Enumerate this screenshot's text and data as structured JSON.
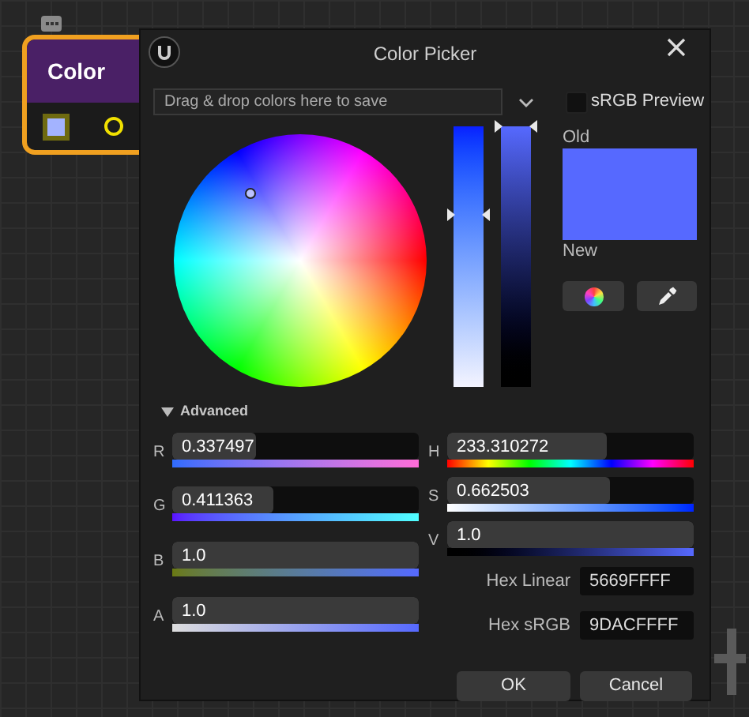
{
  "node": {
    "title": "Color"
  },
  "dialog": {
    "title": "Color Picker"
  },
  "swatch_bar": {
    "placeholder": "Drag & drop colors here to save"
  },
  "srgb_preview": {
    "label": "sRGB Preview",
    "checked": false
  },
  "saturation_bar": {
    "level": 0.662503
  },
  "value_bar": {
    "level": 1.0
  },
  "old_label": "Old",
  "new_label": "New",
  "advanced": {
    "label": "Advanced",
    "expanded": true
  },
  "rgba": [
    {
      "label": "R",
      "value": "0.337497",
      "level": 0.337497
    },
    {
      "label": "G",
      "value": "0.411363",
      "level": 0.411363
    },
    {
      "label": "B",
      "value": "1.0",
      "level": 1.0
    },
    {
      "label": "A",
      "value": "1.0",
      "level": 1.0
    }
  ],
  "hsv": [
    {
      "label": "H",
      "value": "233.310272",
      "level": 0.648084
    },
    {
      "label": "S",
      "value": "0.662503",
      "level": 0.662503
    },
    {
      "label": "V",
      "value": "1.0",
      "level": 1.0
    }
  ],
  "hex": [
    {
      "label": "Hex Linear",
      "value": "5669FFFF"
    },
    {
      "label": "Hex sRGB",
      "value": "9DACFFFF"
    }
  ],
  "buttons": [
    "OK",
    "Cancel"
  ]
}
